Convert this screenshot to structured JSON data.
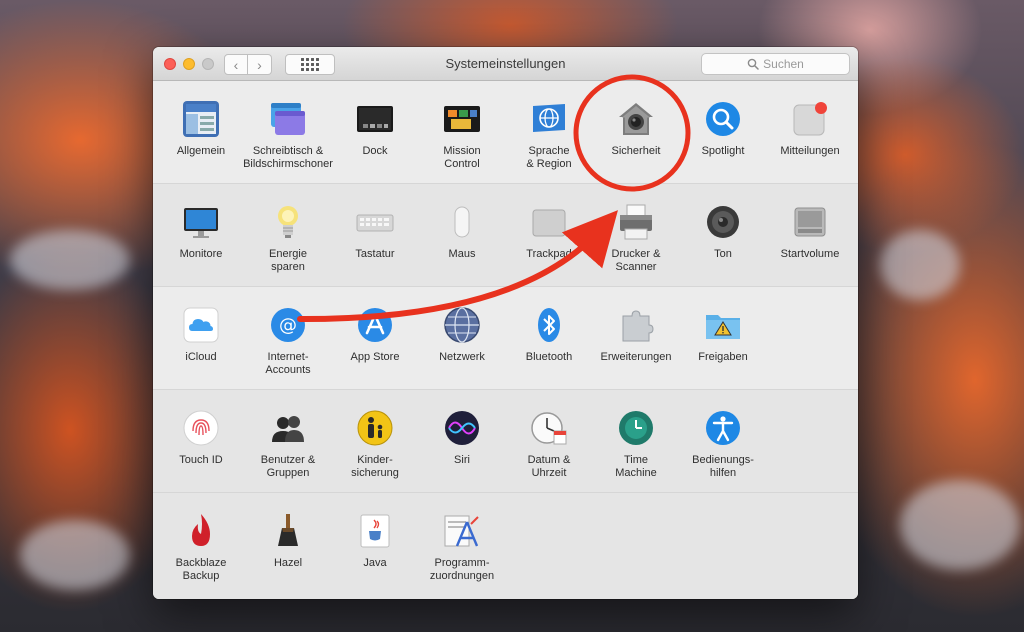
{
  "window": {
    "title": "Systemeinstellungen",
    "search_placeholder": "Suchen",
    "nav_back_glyph": "‹",
    "nav_forward_glyph": "›"
  },
  "colors": {
    "annotation_red": "#e8321e",
    "traffic_close": "#fc5f57",
    "traffic_minimize": "#fdbc2e"
  },
  "rows": [
    {
      "items": [
        {
          "label": "Allgemein",
          "icon": "general-icon"
        },
        {
          "label": "Schreibtisch &\nBildschirmschoner",
          "icon": "desktop-screensaver-icon"
        },
        {
          "label": "Dock",
          "icon": "dock-icon"
        },
        {
          "label": "Mission\nControl",
          "icon": "mission-control-icon"
        },
        {
          "label": "Sprache\n& Region",
          "icon": "language-region-icon"
        },
        {
          "label": "Sicherheit",
          "icon": "security-house-icon"
        },
        {
          "label": "Spotlight",
          "icon": "spotlight-icon"
        },
        {
          "label": "Mitteilungen",
          "icon": "notifications-icon"
        }
      ]
    },
    {
      "items": [
        {
          "label": "Monitore",
          "icon": "displays-icon"
        },
        {
          "label": "Energie\nsparen",
          "icon": "energy-bulb-icon"
        },
        {
          "label": "Tastatur",
          "icon": "keyboard-icon"
        },
        {
          "label": "Maus",
          "icon": "mouse-icon"
        },
        {
          "label": "Trackpad",
          "icon": "trackpad-icon"
        },
        {
          "label": "Drucker &\nScanner",
          "icon": "printer-icon"
        },
        {
          "label": "Ton",
          "icon": "speaker-icon"
        },
        {
          "label": "Startvolume",
          "icon": "startup-disk-icon"
        }
      ]
    },
    {
      "items": [
        {
          "label": "iCloud",
          "icon": "icloud-icon"
        },
        {
          "label": "Internet-\nAccounts",
          "icon": "internet-accounts-icon"
        },
        {
          "label": "App Store",
          "icon": "app-store-icon"
        },
        {
          "label": "Netzwerk",
          "icon": "network-globe-icon"
        },
        {
          "label": "Bluetooth",
          "icon": "bluetooth-icon"
        },
        {
          "label": "Erweiterungen",
          "icon": "extensions-puzzle-icon"
        },
        {
          "label": "Freigaben",
          "icon": "sharing-folder-icon"
        }
      ]
    },
    {
      "items": [
        {
          "label": "Touch ID",
          "icon": "touch-id-icon"
        },
        {
          "label": "Benutzer &\nGruppen",
          "icon": "users-groups-icon"
        },
        {
          "label": "Kinder-\nsicherung",
          "icon": "parental-controls-icon"
        },
        {
          "label": "Siri",
          "icon": "siri-icon"
        },
        {
          "label": "Datum &\nUhrzeit",
          "icon": "date-time-icon"
        },
        {
          "label": "Time\nMachine",
          "icon": "time-machine-icon"
        },
        {
          "label": "Bedienungs-\nhilfen",
          "icon": "accessibility-icon"
        }
      ]
    },
    {
      "items": [
        {
          "label": "Backblaze\nBackup",
          "icon": "backblaze-flame-icon"
        },
        {
          "label": "Hazel",
          "icon": "hazel-broom-icon"
        },
        {
          "label": "Java",
          "icon": "java-cup-icon"
        },
        {
          "label": "Programm-\nzuordnungen",
          "icon": "app-assignments-icon"
        }
      ]
    }
  ]
}
